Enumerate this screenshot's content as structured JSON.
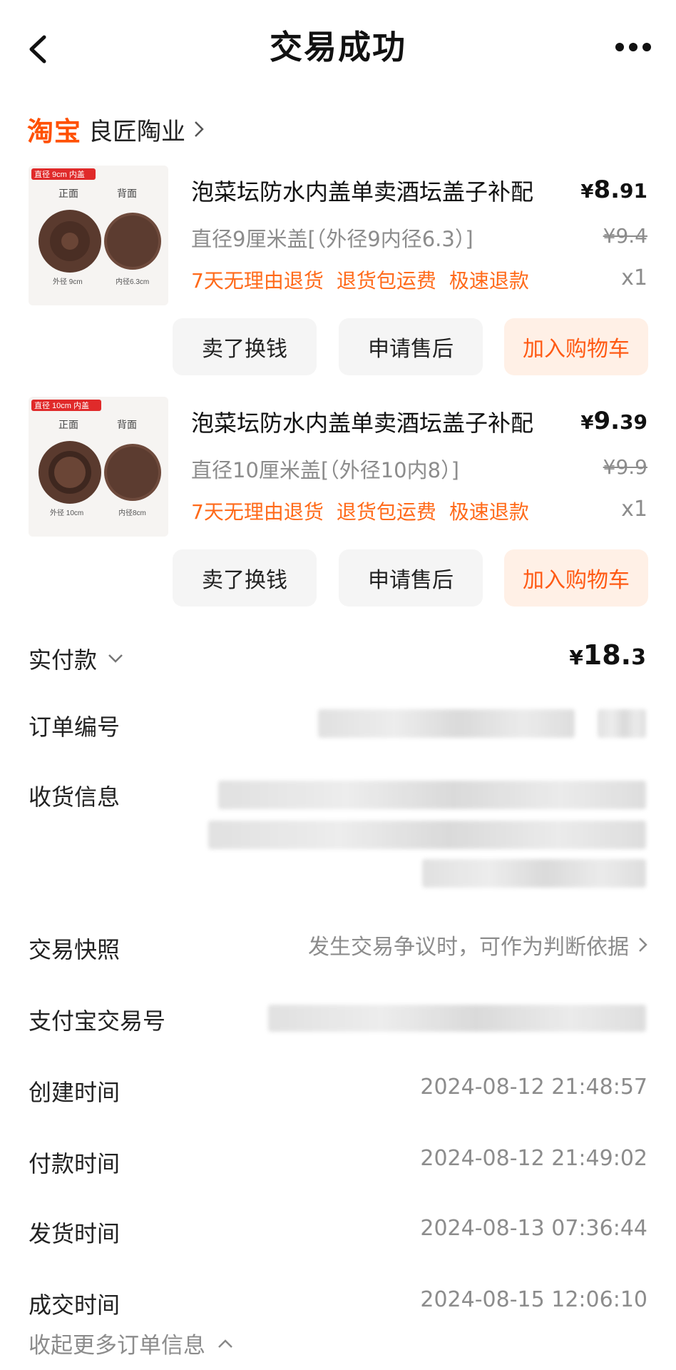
{
  "header": {
    "title": "交易成功"
  },
  "shop": {
    "platform_logo": "淘宝",
    "name": "良匠陶业"
  },
  "products": [
    {
      "title": "泡菜坛防水内盖单卖酒坛盖子补配",
      "price_currency": "¥",
      "price_int": "8.",
      "price_dec": "91",
      "spec": "直径9厘米盖[（外径9内径6.3）]",
      "original_price": "¥9.4",
      "tags": [
        "7天无理由退货",
        "退货包运费",
        "极速退款"
      ],
      "quantity": "x1",
      "thumb": {
        "badge": "直径 9cm 内盖",
        "front_label": "正面",
        "back_label": "背面",
        "outer_label": "外径 9cm",
        "inner_label": "内径6.3cm"
      },
      "actions": [
        "卖了换钱",
        "申请售后",
        "加入购物车"
      ]
    },
    {
      "title": "泡菜坛防水内盖单卖酒坛盖子补配",
      "price_currency": "¥",
      "price_int": "9.",
      "price_dec": "39",
      "spec": "直径10厘米盖[（外径10内8）]",
      "original_price": "¥9.9",
      "tags": [
        "7天无理由退货",
        "退货包运费",
        "极速退款"
      ],
      "quantity": "x1",
      "thumb": {
        "badge": "直径 10cm 内盖",
        "front_label": "正面",
        "back_label": "背面",
        "outer_label": "外径 10cm",
        "inner_label": "内径8cm"
      },
      "actions": [
        "卖了换钱",
        "申请售后",
        "加入购物车"
      ]
    }
  ],
  "order": {
    "paid_label": "实付款",
    "paid_currency": "¥",
    "paid_int": "18.",
    "paid_dec": "3",
    "order_no_label": "订单编号",
    "shipping_label": "收货信息",
    "snapshot_label": "交易快照",
    "snapshot_value": "发生交易争议时，可作为判断依据",
    "alipay_label": "支付宝交易号",
    "created_label": "创建时间",
    "created_value": "2024-08-12 21:48:57",
    "paid_time_label": "付款时间",
    "paid_time_value": "2024-08-12 21:49:02",
    "shipped_label": "发货时间",
    "shipped_value": "2024-08-13 07:36:44",
    "completed_label": "成交时间",
    "completed_value": "2024-08-15 12:06:10",
    "collapse_label": "收起更多订单信息"
  },
  "colors": {
    "accent": "#ff5000",
    "tag_orange": "#ff6a1a",
    "cart_bg": "#fff0e6",
    "muted_text": "#8c8c8c"
  },
  "icons": [
    "back-arrow-icon",
    "more-icon",
    "chevron-right-icon",
    "chevron-down-icon",
    "chevron-up-icon"
  ]
}
